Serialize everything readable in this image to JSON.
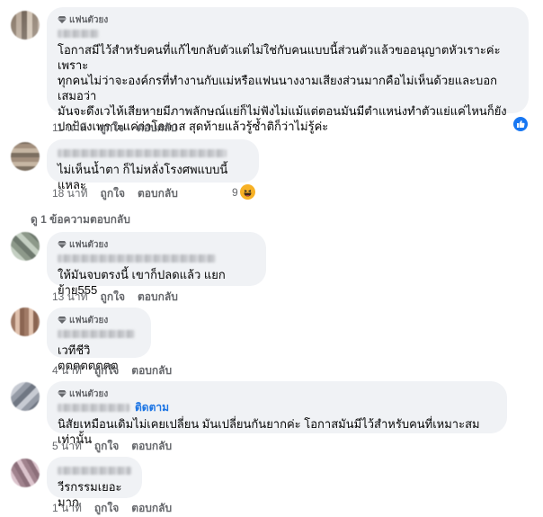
{
  "colors": {
    "bubble": "#f0f2f5",
    "link_blue": "#1b74e4",
    "muted": "#65676b"
  },
  "comments": [
    {
      "badge": "แฟนตัวยง",
      "text": "โอกาสมีไว้สำหรับคนที่แก้ไขกลับตัวแต่ไม่ใช่กับคนแบบนี้ส่วนตัวแล้วขออนุญาตหัวเราะค่ะเพราะ\nทุกคนไม่ว่าจะองค์กรที่ทำงานกับแม่หรือแฟนนางงามเสียงส่วนมากคือไม่เห็นด้วยและบอกเสมอว่า\nมันจะดึงเวไห้เสียหายมีภาพลักษณ์แย่ก็ไม่ฟังไม่แม้แต่ตอนมันมีตำแหน่งทำตัวแย่แค่ไหนก็ยัง\nปกป้องเพราะแค่ว่าโอกาส สุดท้ายแล้วรู้ซ้ำติก็ว่าไม่รู้ค่ะ",
      "time": "11 นาที",
      "like": "ถูกใจ",
      "reply": "ตอบกลับ",
      "reaction": {
        "icon": "like-icon",
        "count": ""
      }
    },
    {
      "badge": "",
      "text": "ไม่เห็นน้ำตา ก็ไม่หลั่งโรงศพแบบนี้แหละ",
      "time": "18 นาที",
      "like": "ถูกใจ",
      "reply": "ตอบกลับ",
      "reaction": {
        "icon": "haha-icon",
        "count": "9"
      }
    },
    {
      "badge": "แฟนตัวยง",
      "text": "ให้มันจบตรงนี้ เขาก็ปลดแล้ว แยกย้าย555",
      "time": "13 นาที",
      "like": "ถูกใจ",
      "reply": "ตอบกลับ",
      "reaction": null
    },
    {
      "badge": "แฟนตัวยง",
      "text": "เวทีชีวิตตตตตตตต",
      "time": "4 นาที",
      "like": "ถูกใจ",
      "reply": "ตอบกลับ",
      "reaction": null
    },
    {
      "badge": "แฟนตัวยง",
      "follow": "ติดตาม",
      "text": "นิสัยเหมือนเดิมไม่เคยเปลี่ยน มันเปลี่ยนกันยากค่ะ โอกาสมันมีไว้สำหรับคนที่เหมาะสมเท่านั้น",
      "time": "5 นาที",
      "like": "ถูกใจ",
      "reply": "ตอบกลับ",
      "reaction": null
    },
    {
      "badge": "",
      "text": "วีรกรรมเยอะมาก",
      "time": "1 นาที",
      "like": "ถูกใจ",
      "reply": "ตอบกลับ",
      "reaction": null
    }
  ],
  "view_replies": "ดู 1 ข้อความตอบกลับ"
}
